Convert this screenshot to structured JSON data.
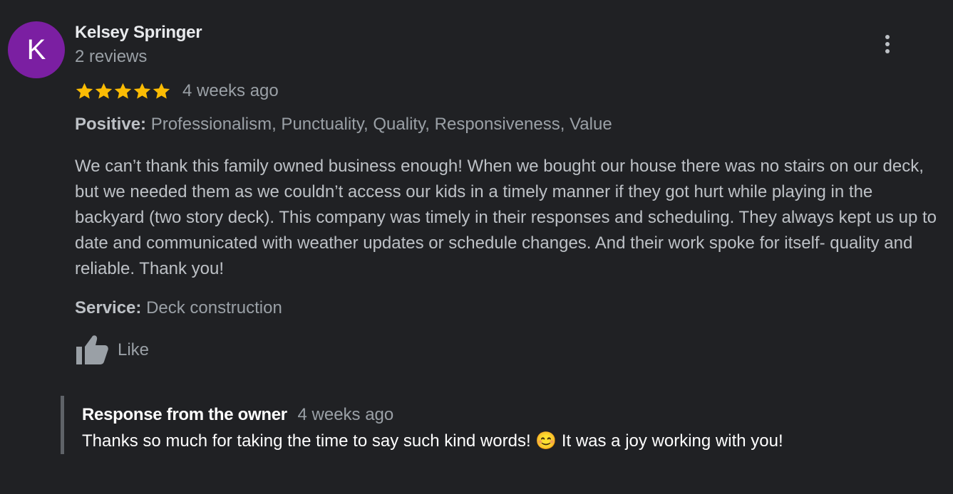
{
  "review": {
    "avatar_letter": "K",
    "avatar_color": "#7b1fa2",
    "author_name": "Kelsey Springer",
    "review_count": "2 reviews",
    "rating": 5,
    "rating_max": 5,
    "star_color": "#fbbc04",
    "date": "4 weeks ago",
    "positive_label": "Positive:",
    "positive_values": "Professionalism, Punctuality, Quality, Responsiveness, Value",
    "text": "We can’t thank this family owned business enough! When we bought our house there was no stairs on our deck, but we needed them as we couldn’t access our kids in a timely manner if they got hurt while playing in the backyard (two story deck). This company was timely in their responses and scheduling. They always kept us up to date and communicated with weather updates or schedule changes. And their work spoke for itself- quality and reliable. Thank you!",
    "service_label": "Service:",
    "service_value": "Deck construction",
    "like_label": "Like",
    "more_icon": "more-vert-icon",
    "like_icon": "thumbs-up-icon"
  },
  "owner_response": {
    "title": "Response from the owner",
    "date": "4 weeks ago",
    "text": "Thanks so much for taking the time to say such kind words! 😊 It was a joy working with you!"
  }
}
